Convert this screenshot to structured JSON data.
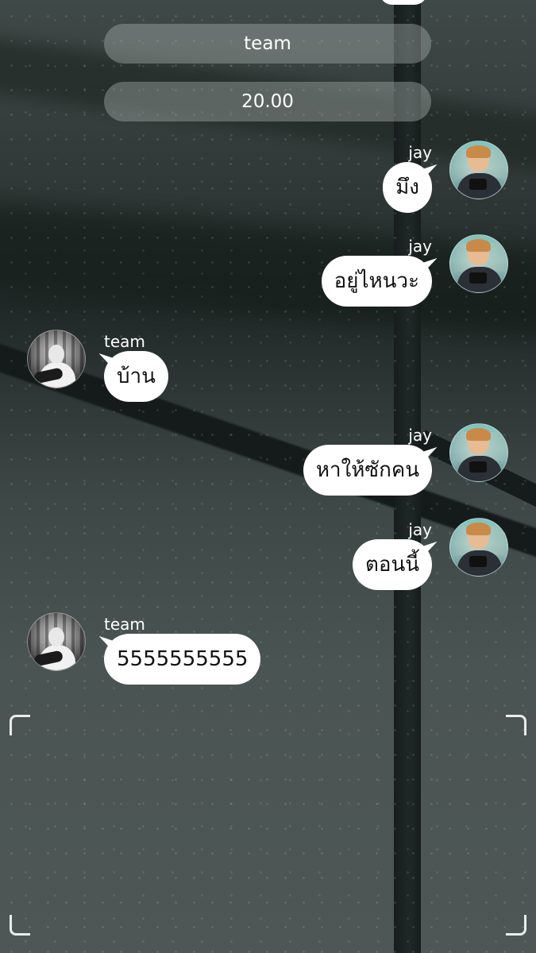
{
  "header": {
    "group_name": "team",
    "time": "20.00"
  },
  "messages": [
    {
      "sender": "jay",
      "side": "right",
      "avatar": "jay-avatar",
      "text": "มึง"
    },
    {
      "sender": "jay",
      "side": "right",
      "avatar": "jay-avatar",
      "text": "อยู่ไหนวะ"
    },
    {
      "sender": "team",
      "side": "left",
      "avatar": "team-avatar",
      "text": "บ้าน"
    },
    {
      "sender": "jay",
      "side": "right",
      "avatar": "jay-avatar",
      "text": "หาให้ซักคน"
    },
    {
      "sender": "jay",
      "side": "right",
      "avatar": "jay-avatar",
      "text": "ตอนนี้"
    },
    {
      "sender": "team",
      "side": "left",
      "avatar": "team-avatar",
      "text": "5555555555"
    }
  ],
  "colors": {
    "bubble": "#ffffff",
    "pill": "#aab0ae",
    "text_on_wallpaper": "#ffffff"
  }
}
